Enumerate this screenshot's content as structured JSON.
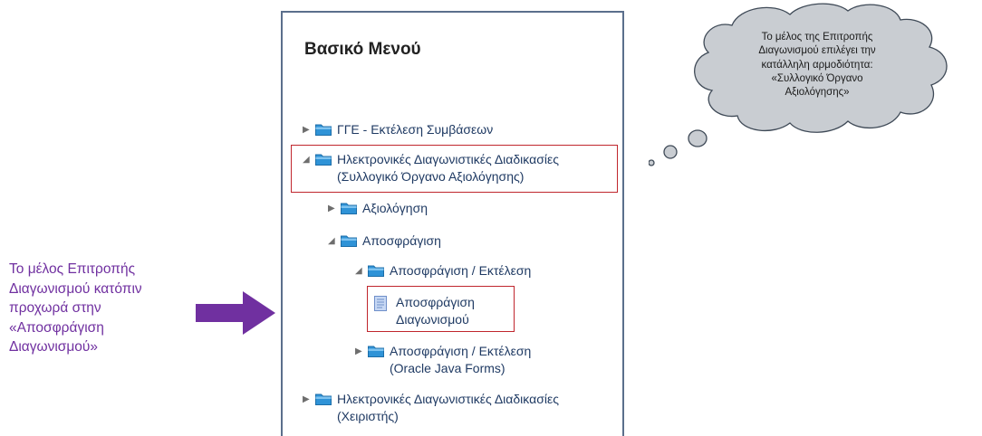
{
  "menu": {
    "title": "Βασικό Μενού",
    "items": [
      {
        "label": [
          "ΓΓΕ - Εκτέλεση Συμβάσεων"
        ],
        "icon": "folder-icon",
        "state": "collapsed"
      },
      {
        "label": [
          "Ηλεκτρονικές Διαγωνιστικές Διαδικασίες",
          "(Συλλογικό Όργανο Αξιολόγησης)"
        ],
        "icon": "folder-icon",
        "state": "expanded",
        "highlighted": true
      },
      {
        "label": [
          "Αξιολόγηση"
        ],
        "icon": "folder-icon",
        "state": "collapsed"
      },
      {
        "label": [
          "Αποσφράγιση"
        ],
        "icon": "folder-icon",
        "state": "expanded"
      },
      {
        "label": [
          "Αποσφράγιση / Εκτέλεση"
        ],
        "icon": "folder-icon",
        "state": "expanded"
      },
      {
        "label": [
          "Αποσφράγιση",
          "Διαγωνισμού"
        ],
        "icon": "page-icon",
        "state": "leaf",
        "highlighted": true
      },
      {
        "label": [
          "Αποσφράγιση / Εκτέλεση",
          "(Oracle Java Forms)"
        ],
        "icon": "folder-icon",
        "state": "collapsed"
      },
      {
        "label": [
          "Ηλεκτρονικές Διαγωνιστικές Διαδικασίες",
          "(Χειριστής)"
        ],
        "icon": "folder-icon",
        "state": "collapsed"
      }
    ]
  },
  "callout": {
    "lines": [
      "Το μέλος της Επιτροπής",
      "Διαγωνισμού επιλέγει την",
      "κατάλληλη αρμοδιότητα:",
      "«Συλλογικό Όργανο",
      "Αξιολόγησης»"
    ]
  },
  "annotation": {
    "lines": [
      "Το μέλος Επιτροπής",
      "Διαγωνισμού κατόπιν",
      "προχωρά στην",
      "«Αποσφράγιση",
      "Διαγωνισμού»"
    ]
  },
  "colors": {
    "link": "#1f3a63",
    "highlight_border": "#c0262d",
    "annotation_text": "#7030a0",
    "arrow_fill": "#7030a0",
    "cloud_fill": "#c9cdd2",
    "panel_border": "#5b6f8c"
  }
}
